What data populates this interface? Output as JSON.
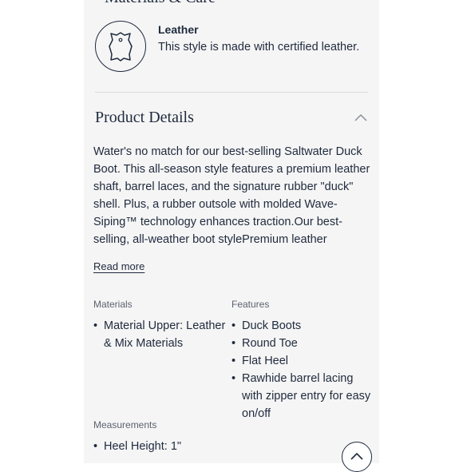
{
  "section_above_title": "Materials & Care",
  "leather": {
    "icon": "leather-hide-icon",
    "title": "Leather",
    "description": "This style is made with certified leather."
  },
  "product_details": {
    "title": "Product Details",
    "toggle_icon": "chevron-up-icon",
    "description": "Water's no match for our best-selling Saltwater Duck Boot. This all-season style features a premium leather shaft, barrel laces, and the signature rubber \"duck\" shell. Plus, a rubber outsole with molded Wave-Siping™ technology enhances traction.Our best-selling, all-weather boot stylePremium leather shaftWaterproof",
    "read_more_label": "Read more",
    "materials": {
      "label": "Materials",
      "items": [
        "Material Upper: Leather & Mix Materials"
      ]
    },
    "features": {
      "label": "Features",
      "items": [
        "Duck Boots",
        "Round Toe",
        "Flat Heel",
        "Rawhide barrel lacing with zipper entry for easy on/off"
      ]
    },
    "measurements": {
      "label": "Measurements",
      "items": [
        "Heel Height: 1\""
      ]
    }
  },
  "scroll_top_icon": "chevron-up-icon"
}
